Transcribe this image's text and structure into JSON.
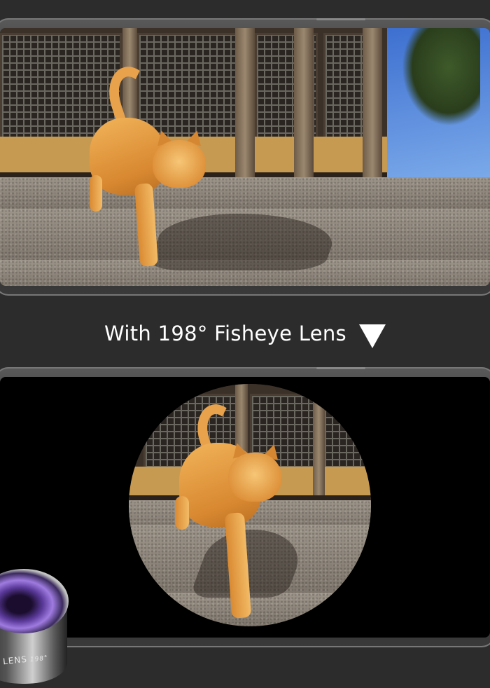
{
  "caption": {
    "text": "With 198°  Fisheye Lens",
    "arrow_icon": "down-triangle-icon"
  },
  "top_photo": {
    "subject": "orange-tabby-cat-on-temple-steps"
  },
  "bottom_photo": {
    "subject": "orange-tabby-cat-on-temple-steps",
    "shape": "circular"
  },
  "lens_product": {
    "brand_text": "LENS",
    "angle_text": "198°"
  },
  "colors": {
    "background": "#2c2c2c",
    "caption_text": "#ffffff"
  }
}
